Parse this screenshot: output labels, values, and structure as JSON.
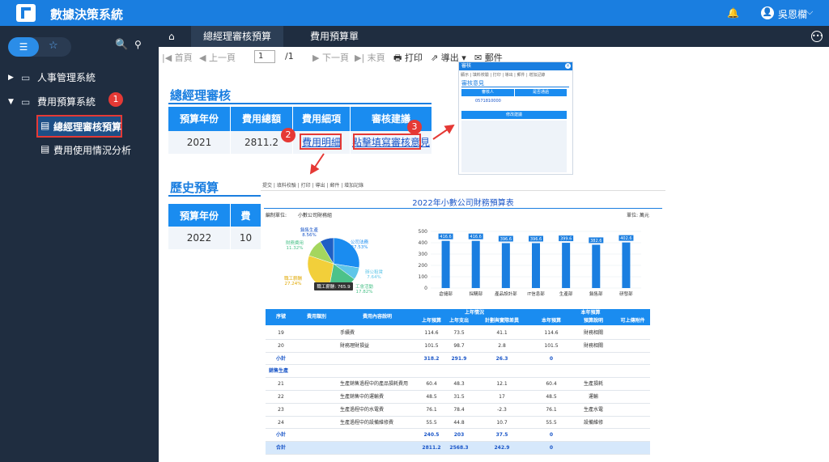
{
  "app": {
    "title": "數據決策系統",
    "user": "吳恩欄"
  },
  "sidebar": {
    "items": [
      {
        "label": "人事管理系統"
      },
      {
        "label": "費用預算系統"
      }
    ],
    "children": [
      {
        "label": "總經理審核預算"
      },
      {
        "label": "費用使用情況分析"
      }
    ],
    "badges": [
      "1",
      "2",
      "3"
    ]
  },
  "tabs": [
    {
      "label": "總經理審核預算"
    },
    {
      "label": "費用預算單"
    }
  ],
  "toolbar": {
    "first": "首頁",
    "prev": "上一頁",
    "page": "1",
    "total": "/1",
    "next": "下一頁",
    "last": "末頁",
    "print": "打印",
    "export": "導出",
    "mail": "郵件"
  },
  "report": {
    "title": "總經理審核",
    "headers": [
      "預算年份",
      "費用總額",
      "費用細項",
      "審核建議"
    ],
    "row": {
      "year": "2021",
      "total": "2811.2",
      "detail": "費用明細",
      "review": "點擊填寫審核意見"
    }
  },
  "history": {
    "title": "歷史預算",
    "headers": [
      "預算年份",
      "費"
    ],
    "row": {
      "year": "2022",
      "total": "10"
    }
  },
  "popup": {
    "header": "審核",
    "tools": "顯示 | 填料校驗 | 打印 | 導出 | 郵件 | 增加記錄",
    "title": "審核意見",
    "th1": "審核人",
    "th2": "是否通過",
    "td1": "0571810000",
    "td2": "",
    "button": "修改建議",
    "empty": ""
  },
  "embed": {
    "tools": "提交 | 填料校驗 | 打印 | 導出 | 郵件 | 增加記錄",
    "title": "2022年小數公司財務預算表",
    "unit_label": "編制單位:",
    "unit_value": "小數公司財務組",
    "currency": "單位: 萬元",
    "pie_labels": [
      {
        "label": "銷售生產",
        "pct": "8.56%"
      },
      {
        "label": "公司法務",
        "pct": "27.53%"
      },
      {
        "label": "財務費用",
        "pct": "11.32%"
      },
      {
        "label": "辦公租賃",
        "pct": "7.64%"
      },
      {
        "label": "職工薪酬",
        "pct": "27.24%"
      },
      {
        "label": "工會活動",
        "pct": "17.82%"
      }
    ],
    "pie_tooltip": "職工薪酬: 765.9",
    "table_headers": {
      "seq": "序號",
      "cat": "費用類別",
      "desc": "費用內容說明",
      "prev_year": "上年情況",
      "this_year": "本年預算",
      "cols": [
        "上年預算",
        "上年支出",
        "計劃與實際差異",
        "本年預算",
        "預算說明",
        "可上傳附件"
      ]
    },
    "rows": [
      {
        "seq": "19",
        "desc": "手續費",
        "a": "114.6",
        "b": "73.5",
        "c": "41.1",
        "d": "114.6",
        "e": "財務相關",
        "f": ""
      },
      {
        "seq": "20",
        "desc": "財務理財損益",
        "a": "101.5",
        "b": "98.7",
        "c": "2.8",
        "d": "101.5",
        "e": "財務相關",
        "f": ""
      },
      {
        "seq": "小計",
        "desc": "",
        "a": "318.2",
        "b": "291.9",
        "c": "26.3",
        "d": "0",
        "e": "",
        "f": ""
      },
      {
        "seq": "銷售生產",
        "desc": "",
        "a": "",
        "b": "",
        "c": "",
        "d": "",
        "e": "",
        "f": ""
      },
      {
        "seq": "21",
        "desc": "生產銷售過程中的產品損耗費用",
        "a": "60.4",
        "b": "48.3",
        "c": "12.1",
        "d": "60.4",
        "e": "生產損耗",
        "f": ""
      },
      {
        "seq": "22",
        "desc": "生產銷售中的運輸費",
        "a": "48.5",
        "b": "31.5",
        "c": "17",
        "d": "48.5",
        "e": "運輸",
        "f": ""
      },
      {
        "seq": "23",
        "desc": "生產過程中的水電費",
        "a": "76.1",
        "b": "78.4",
        "c": "-2.3",
        "d": "76.1",
        "e": "生產水電",
        "f": ""
      },
      {
        "seq": "24",
        "desc": "生產過程中的設備維修費",
        "a": "55.5",
        "b": "44.8",
        "c": "10.7",
        "d": "55.5",
        "e": "設備維修",
        "f": ""
      },
      {
        "seq": "小計",
        "desc": "",
        "a": "240.5",
        "b": "203",
        "c": "37.5",
        "d": "0",
        "e": "",
        "f": ""
      },
      {
        "seq": "合計",
        "desc": "",
        "a": "2811.2",
        "b": "2568.3",
        "c": "242.9",
        "d": "0",
        "e": "",
        "f": ""
      }
    ]
  },
  "chart_data": {
    "type": "bar",
    "categories": [
      "倉儲部",
      "採購部",
      "產品設計部",
      "IT信息部",
      "生產部",
      "銷售部",
      "研發部"
    ],
    "values": [
      416.6,
      416.6,
      396.6,
      396.6,
      399.6,
      382.6,
      402.6
    ],
    "ylim": [
      0,
      500
    ],
    "yticks": [
      0,
      100,
      200,
      300,
      400,
      500
    ],
    "color": "#1a7ee0"
  },
  "pie_data": {
    "type": "pie",
    "slices": [
      {
        "label": "公司法務",
        "value": 27.53,
        "color": "#1a8cf0"
      },
      {
        "label": "辦公租賃",
        "value": 7.64,
        "color": "#5fc6e8"
      },
      {
        "label": "工會活動",
        "value": 17.82,
        "color": "#4cc28a"
      },
      {
        "label": "職工薪酬",
        "value": 27.24,
        "color": "#f2cf3a"
      },
      {
        "label": "財務費用",
        "value": 11.32,
        "color": "#a4d65e"
      },
      {
        "label": "銷售生產",
        "value": 8.56,
        "color": "#1f5fc4"
      }
    ]
  }
}
